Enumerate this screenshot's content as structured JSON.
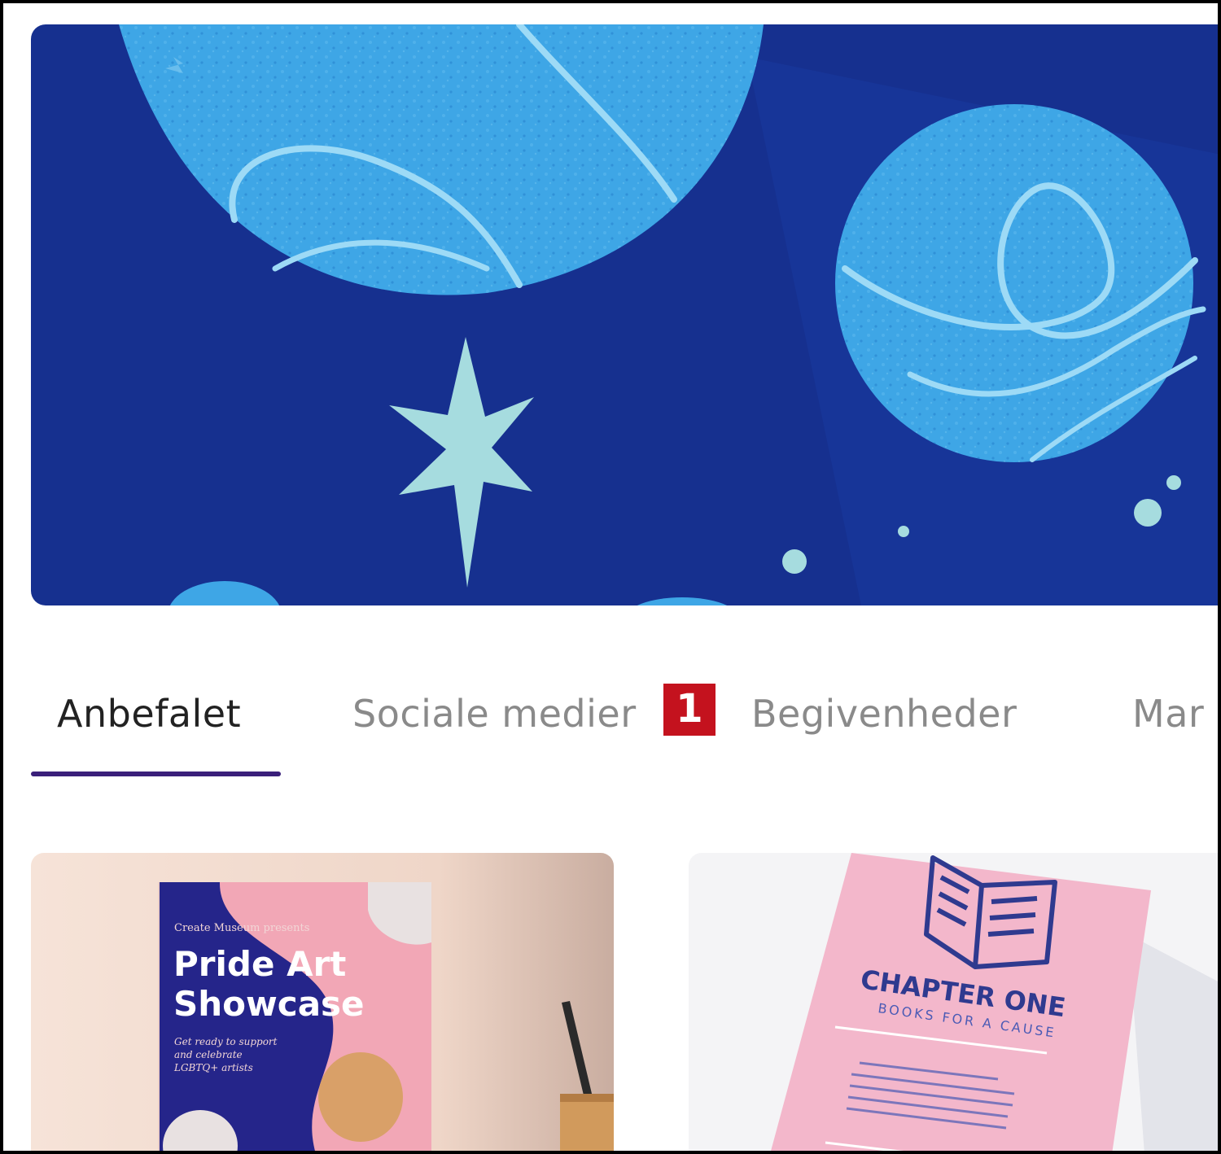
{
  "tabs": [
    {
      "label": "Anbefalet",
      "active": true
    },
    {
      "label": "Sociale medier",
      "active": false
    },
    {
      "label": "Begivenheder",
      "active": false
    },
    {
      "label": "Mar",
      "active": false
    }
  ],
  "badge": {
    "count": "1",
    "color": "#c4121e"
  },
  "colors": {
    "banner_bg": "#16308f",
    "accent": "#3a1f7a"
  },
  "cards": [
    {
      "title_line1": "Pride Art",
      "title_line2": "Showcase",
      "small_top": "Create Museum presents",
      "small_lines": [
        "Get ready to support",
        "and celebrate",
        "LGBTQ+ artists"
      ]
    },
    {
      "title": "CHAPTER ONE",
      "subtitle": "BOOKS FOR A CAUSE"
    }
  ]
}
